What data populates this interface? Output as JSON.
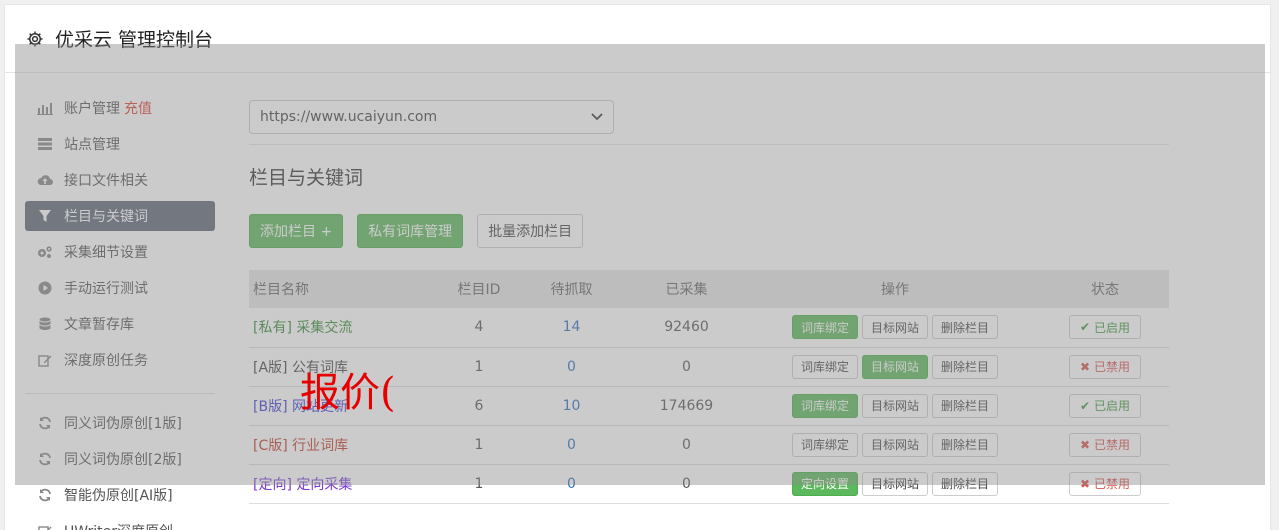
{
  "header": {
    "title": "优采云 管理控制台",
    "icon": "gear-icon"
  },
  "sidebar": {
    "items": [
      {
        "label": "账户管理",
        "extra": "充值",
        "icon": "bar-chart-icon"
      },
      {
        "label": "站点管理",
        "icon": "server-icon"
      },
      {
        "label": "接口文件相关",
        "icon": "cloud-upload-icon"
      },
      {
        "label": "栏目与关键词",
        "icon": "filter-icon",
        "active": true
      },
      {
        "label": "采集细节设置",
        "icon": "gears-icon"
      },
      {
        "label": "手动运行测试",
        "icon": "play-icon"
      },
      {
        "label": "文章暂存库",
        "icon": "database-icon"
      },
      {
        "label": "深度原创任务",
        "icon": "edit-icon"
      }
    ],
    "items2": [
      {
        "label": "同义词伪原创[1版]",
        "icon": "refresh-icon"
      },
      {
        "label": "同义词伪原创[2版]",
        "icon": "refresh-icon"
      },
      {
        "label": "智能伪原创[AI版]",
        "icon": "refresh-icon"
      },
      {
        "label": "UWriter深度原创",
        "icon": "edit-icon"
      }
    ]
  },
  "main": {
    "site_select": "https://www.ucaiyun.com",
    "section_title": "栏目与关键词",
    "buttons": {
      "add": "添加栏目 +",
      "private_lib": "私有词库管理",
      "batch_add": "批量添加栏目"
    }
  },
  "table": {
    "headers": {
      "name": "栏目名称",
      "id": "栏目ID",
      "pending": "待抓取",
      "collected": "已采集",
      "ops": "操作",
      "status": "状态"
    },
    "rows": [
      {
        "tag": "[私有]",
        "name": "采集交流",
        "id": "4",
        "pending": "14",
        "collected": "92460",
        "op1": "词库绑定",
        "op2": "目标网站",
        "op3": "删除栏目",
        "status": "已启用"
      },
      {
        "tag": "[A版]",
        "name": "公有词库",
        "id": "1",
        "pending": "0",
        "collected": "0",
        "op1": "词库绑定",
        "op2": "目标网站",
        "op3": "删除栏目",
        "status": "已禁用"
      },
      {
        "tag": "[B版]",
        "name": "网站更新",
        "id": "6",
        "pending": "10",
        "collected": "174669",
        "op1": "词库绑定",
        "op2": "目标网站",
        "op3": "删除栏目",
        "status": "已启用"
      },
      {
        "tag": "[C版]",
        "name": "行业词库",
        "id": "1",
        "pending": "0",
        "collected": "0",
        "op1": "词库绑定",
        "op2": "目标网站",
        "op3": "删除栏目",
        "status": "已禁用"
      },
      {
        "tag": "[定向]",
        "name": "定向采集",
        "id": "1",
        "pending": "0",
        "collected": "0",
        "op1": "定向设置",
        "op2": "目标网站",
        "op3": "删除栏目",
        "status": "已禁用"
      }
    ]
  },
  "watermark": "报价(",
  "colors": {
    "accent_green": "#5cb85c",
    "active_nav": "#5d6777",
    "danger": "#d9534f",
    "link_blue": "#2a6fbf"
  }
}
